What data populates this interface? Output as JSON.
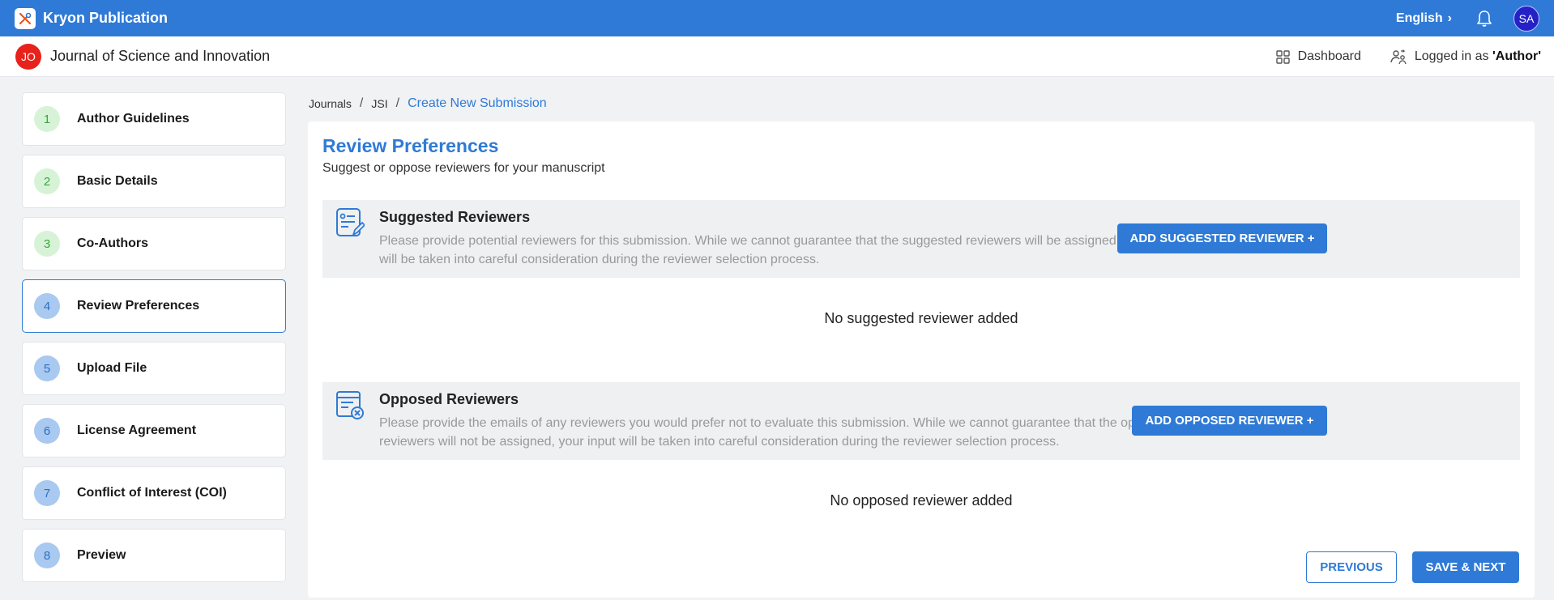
{
  "app": {
    "name": "Kryon Publication",
    "language": "English",
    "user_initials": "SA"
  },
  "journal": {
    "badge": "JO",
    "title": "Journal of Science and Innovation",
    "dashboard_label": "Dashboard",
    "logged_in_prefix": "Logged in as ",
    "logged_in_role": "'Author'"
  },
  "steps": [
    {
      "num": "1",
      "label": "Author Guidelines",
      "state": "done"
    },
    {
      "num": "2",
      "label": "Basic Details",
      "state": "done"
    },
    {
      "num": "3",
      "label": "Co-Authors",
      "state": "done"
    },
    {
      "num": "4",
      "label": "Review Preferences",
      "state": "active"
    },
    {
      "num": "5",
      "label": "Upload File",
      "state": "todo"
    },
    {
      "num": "6",
      "label": "License Agreement",
      "state": "todo"
    },
    {
      "num": "7",
      "label": "Conflict of Interest (COI)",
      "state": "todo"
    },
    {
      "num": "8",
      "label": "Preview",
      "state": "todo"
    }
  ],
  "breadcrumb": {
    "items": [
      "Journals",
      "JSI"
    ],
    "current": "Create New Submission",
    "separator": "/"
  },
  "page": {
    "title": "Review Preferences",
    "subtitle": "Suggest or oppose reviewers for your manuscript"
  },
  "suggested": {
    "title": "Suggested Reviewers",
    "description": "Please provide potential reviewers for this submission. While we cannot guarantee that the suggested reviewers will be assigned, your input will be taken into careful consideration during the reviewer selection process.",
    "button": "ADD SUGGESTED REVIEWER +",
    "empty": "No suggested reviewer added"
  },
  "opposed": {
    "title": "Opposed Reviewers",
    "description": "Please provide the emails of any reviewers you would prefer not to evaluate this submission. While we cannot guarantee that the opposed reviewers will not be assigned, your input will be taken into careful consideration during the reviewer selection process.",
    "button": "ADD OPPOSED REVIEWER +",
    "empty": "No opposed reviewer added"
  },
  "actions": {
    "previous": "PREVIOUS",
    "next": "SAVE & NEXT"
  },
  "colors": {
    "primary": "#2f7ad6",
    "done": "#d7f3d7",
    "todo": "#a9c9f0",
    "journal_badge": "#e8211b",
    "avatar": "#2422c7"
  }
}
